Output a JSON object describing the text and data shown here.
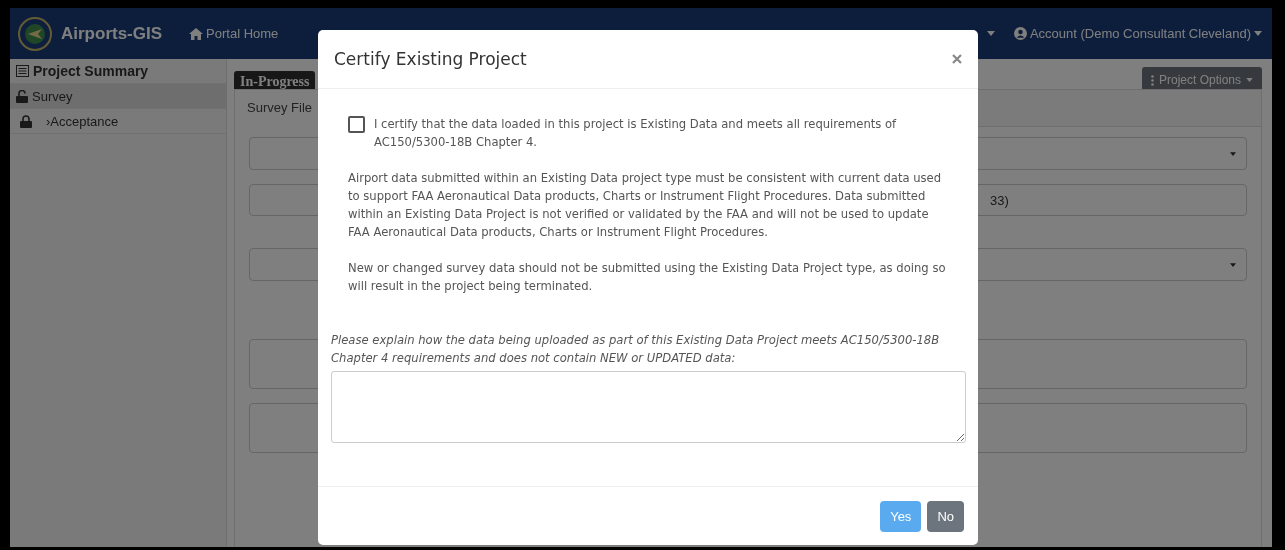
{
  "navbar": {
    "brand": "Airports-GIS",
    "links": [
      {
        "label": "Portal Home"
      }
    ],
    "account": "Account (Demo Consultant Cleveland)"
  },
  "sidebar": {
    "items": [
      {
        "label": "Project Summary",
        "kind": "header",
        "selected": false
      },
      {
        "label": "Survey",
        "kind": "unlocked",
        "selected": true
      },
      {
        "label": "›Acceptance",
        "kind": "locked",
        "selected": false
      }
    ]
  },
  "content": {
    "status_badge": "In-Progress",
    "options_button": "Project Options",
    "tabs": [
      {
        "label": "Survey File",
        "selected": true
      }
    ],
    "fields": [
      {
        "kind": "select"
      },
      {
        "kind": "input",
        "value": "33)"
      },
      {
        "kind": "select"
      },
      {
        "kind": "textarea"
      },
      {
        "kind": "textarea"
      }
    ]
  },
  "modal": {
    "title": "Certify Existing Project",
    "checkbox": {
      "label": "I certify that the data loaded in this project is Existing Data and meets all requirements of AC150/5300-18B Chapter 4.",
      "checked": false
    },
    "paragraphs": [
      "Airport data submitted within an Existing Data project type must be consistent with current data used to support FAA Aeronautical Data products, Charts or Instrument Flight Procedures. Data submitted within an Existing Data Project is not verified or validated by the FAA and will not be used to update FAA Aeronautical Data products, Charts or Instrument Flight Procedures.",
      "New or changed survey data should not be submitted using the Existing Data Project type, as doing so will result in the project being terminated."
    ],
    "prompt": "Please explain how the data being uploaded as part of this Existing Data Project meets AC150/5300-18B Chapter 4 requirements and does not contain NEW or UPDATED data:",
    "buttons": [
      {
        "label": "Yes",
        "kind": "primary"
      },
      {
        "label": "No",
        "kind": "secondary"
      }
    ]
  }
}
